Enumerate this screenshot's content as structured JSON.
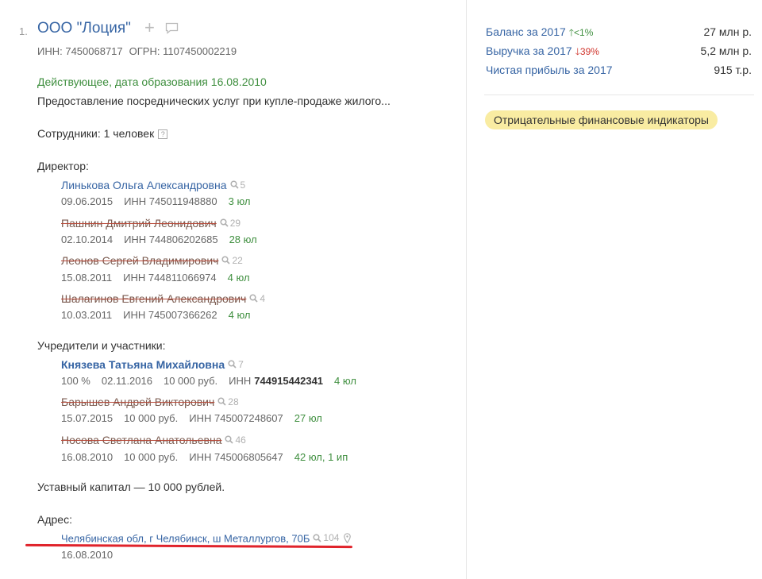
{
  "company": {
    "number": "1.",
    "name": "ООО \"Лоция\"",
    "inn": "ИНН: 7450068717",
    "ogrn": "ОГРН: 1107450002219",
    "status": "Действующее, дата образования 16.08.2010",
    "activity": "Предоставление посреднических услуг при купле-продаже жилого...",
    "employees": "Сотрудники: 1 человек",
    "employees_help": "?"
  },
  "directors_heading": "Директор:",
  "directors": [
    {
      "name": "Линькова Ольга Александровна",
      "count": "5",
      "date": "09.06.2015",
      "inn": "ИНН 745011948880",
      "links": "3 юл",
      "former": false
    },
    {
      "name": "Пашнин Дмитрий Леонидович",
      "count": "29",
      "date": "02.10.2014",
      "inn": "ИНН 744806202685",
      "links": "28 юл",
      "former": true
    },
    {
      "name": "Леонов Сергей Владимирович",
      "count": "22",
      "date": "15.08.2011",
      "inn": "ИНН 744811066974",
      "links": "4 юл",
      "former": true
    },
    {
      "name": "Шалагинов Евгений Александрович",
      "count": "4",
      "date": "10.03.2011",
      "inn": "ИНН 745007366262",
      "links": "4 юл",
      "former": true
    }
  ],
  "founders_heading": "Учредители и участники:",
  "founders": [
    {
      "name": "Князева Татьяна Михайловна",
      "count": "7",
      "share": "100 %",
      "date": "02.11.2016",
      "amount": "10 000 руб.",
      "inn_label": "ИНН",
      "inn_value": "744915442341",
      "links": "4 юл",
      "former": false
    },
    {
      "name": "Барышев Андрей Викторович",
      "count": "28",
      "date": "15.07.2015",
      "amount": "10 000 руб.",
      "inn": "ИНН 745007248607",
      "links": "27 юл",
      "former": true
    },
    {
      "name": "Носова Светлана Анатольевна",
      "count": "46",
      "date": "16.08.2010",
      "amount": "10 000 руб.",
      "inn": "ИНН 745006805647",
      "links": "42 юл, 1 ип",
      "former": true
    }
  ],
  "capital": "Уставный капитал — 10 000 рублей.",
  "address_heading": "Адрес:",
  "address": {
    "text": "Челябинская обл, г Челябинск, ш Металлургов, 70Б",
    "count": "104",
    "date": "16.08.2010"
  },
  "finance": [
    {
      "label": "Баланс за 2017",
      "trend": "up",
      "trend_arrow": "🡑",
      "change": "<1%",
      "value": "27 млн р."
    },
    {
      "label": "Выручка за 2017",
      "trend": "down",
      "trend_arrow": "🡓",
      "change": "39%",
      "value": "5,2 млн р."
    },
    {
      "label": "Чистая прибыль за 2017",
      "trend": "",
      "trend_arrow": "",
      "change": "",
      "value": "915 т.р."
    }
  ],
  "warning_badge": "Отрицательные финансовые индикаторы",
  "colors": {
    "link": "#3765a4",
    "green": "#3f8f3f",
    "red": "#d0342c",
    "badge": "#f9eca2",
    "highlight_line": "#e0232b"
  }
}
